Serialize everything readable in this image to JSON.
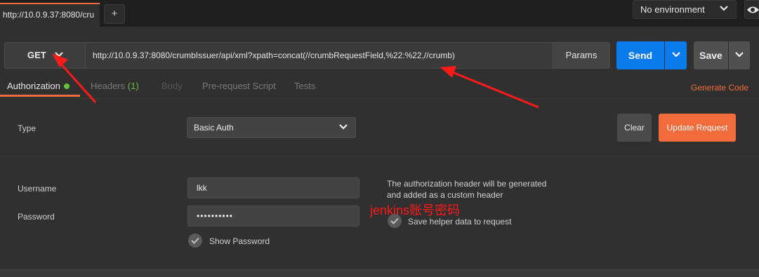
{
  "tabs": {
    "active_tab_title": "http://10.0.9.37:8080/cru",
    "add_tab_label": "+"
  },
  "environment": {
    "selected": "No environment"
  },
  "request": {
    "method": "GET",
    "url": "http://10.0.9.37:8080/crumbIssuer/api/xml?xpath=concat(//crumbRequestField,%22:%22,//crumb)",
    "params_label": "Params",
    "send_label": "Send",
    "save_label": "Save"
  },
  "request_tabs": [
    {
      "label": "Authorization",
      "active": true
    },
    {
      "label": "Headers",
      "count": "(1)"
    },
    {
      "label": "Body",
      "disabled": true
    },
    {
      "label": "Pre-request Script"
    },
    {
      "label": "Tests"
    }
  ],
  "generate_code_label": "Generate Code",
  "auth": {
    "type_label": "Type",
    "type_value": "Basic Auth",
    "clear_label": "Clear",
    "update_label": "Update Request",
    "username_label": "Username",
    "username_value": "lkk",
    "password_label": "Password",
    "password_value": "••••••••••",
    "show_password_label": "Show Password",
    "hint": "The authorization header will be generated and added as a custom header",
    "save_helper_label": "Save helper data to request"
  },
  "annotation": {
    "text": "jenkins账号密码",
    "color": "#ff1a1a"
  },
  "colors": {
    "accent": "#f26b3a",
    "send": "#097bed",
    "status_ok": "#67c23a"
  },
  "icons": [
    "plus-icon",
    "chevron-down-icon",
    "eye-icon",
    "status-dot-icon",
    "check-icon",
    "red-arrow-annotation"
  ]
}
